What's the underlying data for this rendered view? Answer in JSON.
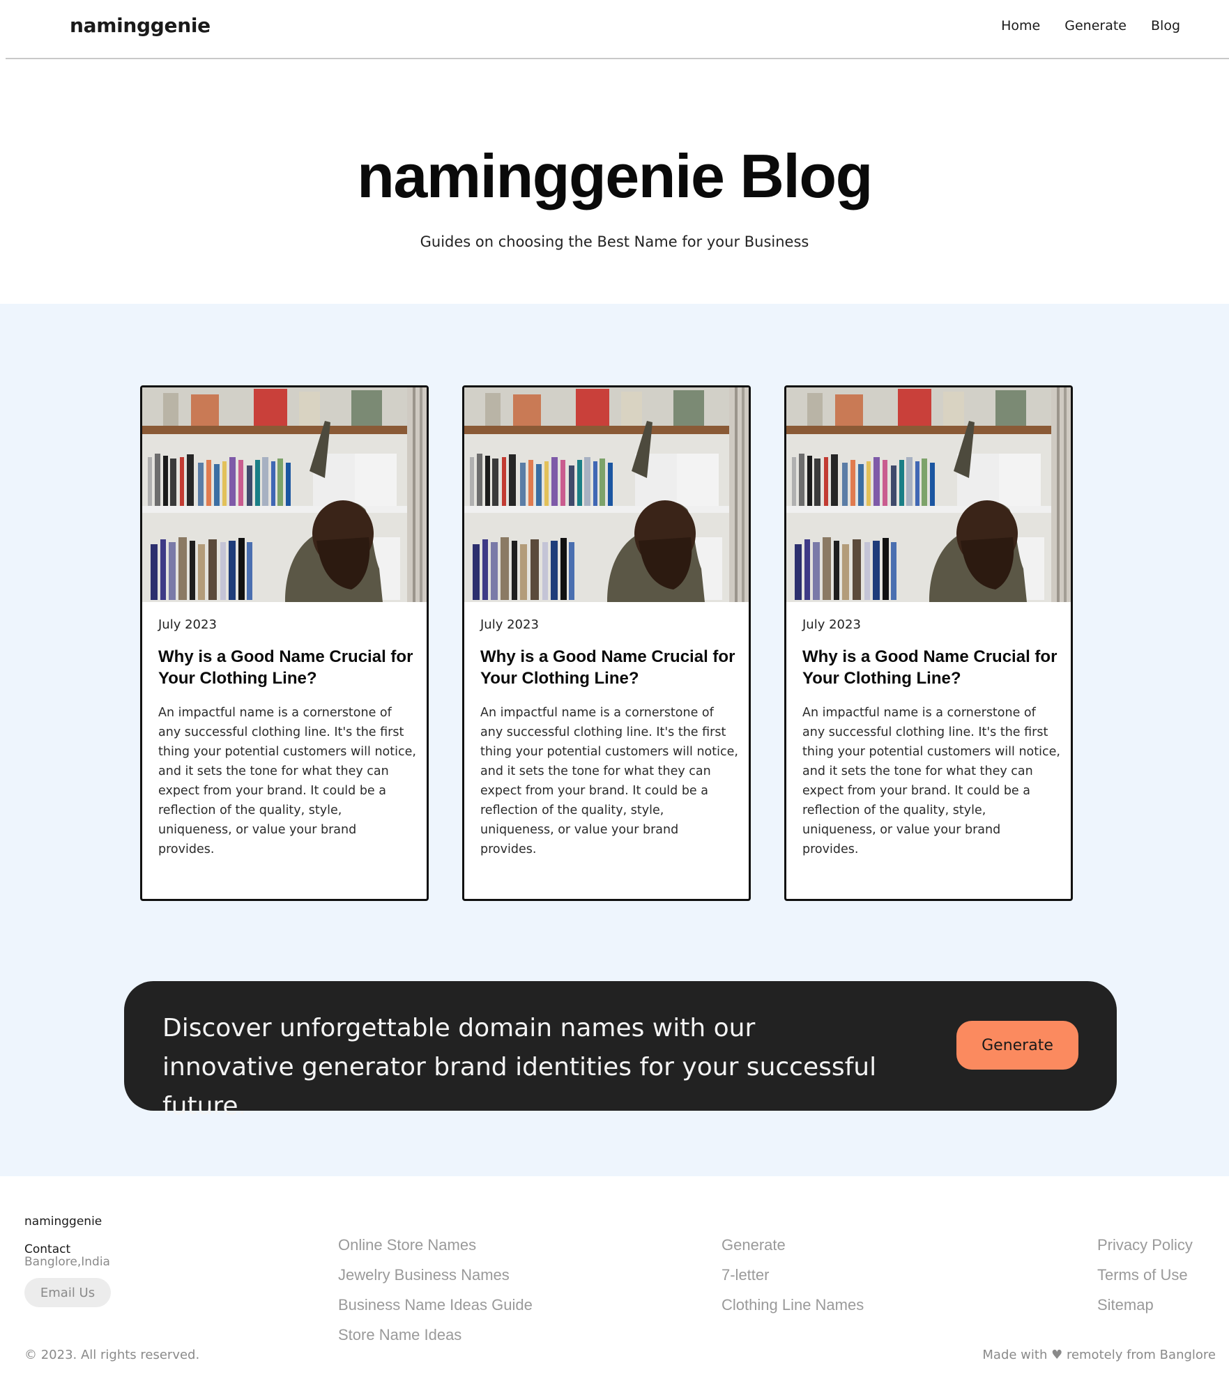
{
  "header": {
    "logo": "naminggenie",
    "nav": [
      "Home",
      "Generate",
      "Blog"
    ]
  },
  "hero": {
    "title": "naminggenie Blog",
    "subtitle": "Guides on choosing the Best Name for your Business"
  },
  "posts": [
    {
      "date": "July 2023",
      "title": "Why is a Good Name Crucial for Your Clothing Line?",
      "excerpt": "An impactful name is a cornerstone of any successful clothing line. It's the first thing your potential customers will notice, and it sets the tone for what they can expect from your brand. It could be a reflection of the quality, style, uniqueness, or value your brand provides."
    },
    {
      "date": "July 2023",
      "title": "Why is a Good Name Crucial for Your Clothing Line?",
      "excerpt": "An impactful name is a cornerstone of any successful clothing line. It's the first thing your potential customers will notice, and it sets the tone for what they can expect from your brand. It could be a reflection of the quality, style, uniqueness, or value your brand provides."
    },
    {
      "date": "July 2023",
      "title": "Why is a Good Name Crucial for Your Clothing Line?",
      "excerpt": "An impactful name is a cornerstone of any successful clothing line. It's the first thing your potential customers will notice, and it sets the tone for what they can expect from your brand. It could be a reflection of the quality, style, uniqueness, or value your brand provides."
    }
  ],
  "cta": {
    "text": "Discover unforgettable domain names with our innovative generator brand identities for your successful future.",
    "button": "Generate"
  },
  "footer": {
    "brand": "naminggenie",
    "contact_label": "Contact",
    "location": "Banglore,India",
    "email_button": "Email Us",
    "col1": [
      "Online Store Names",
      "Jewelry Business Names",
      "Business Name Ideas Guide",
      "Store Name Ideas"
    ],
    "col2": [
      "Generate",
      "7-letter",
      "Clothing Line Names"
    ],
    "col3": [
      "Privacy Policy",
      "Terms of Use",
      "Sitemap"
    ],
    "copyright": "© 2023. All rights reserved.",
    "made_with": "Made with ♥ remotely from Banglore"
  },
  "colors": {
    "section_bg": "#eef5fd",
    "cta_bg": "#222222",
    "accent": "#fb8a5f"
  }
}
